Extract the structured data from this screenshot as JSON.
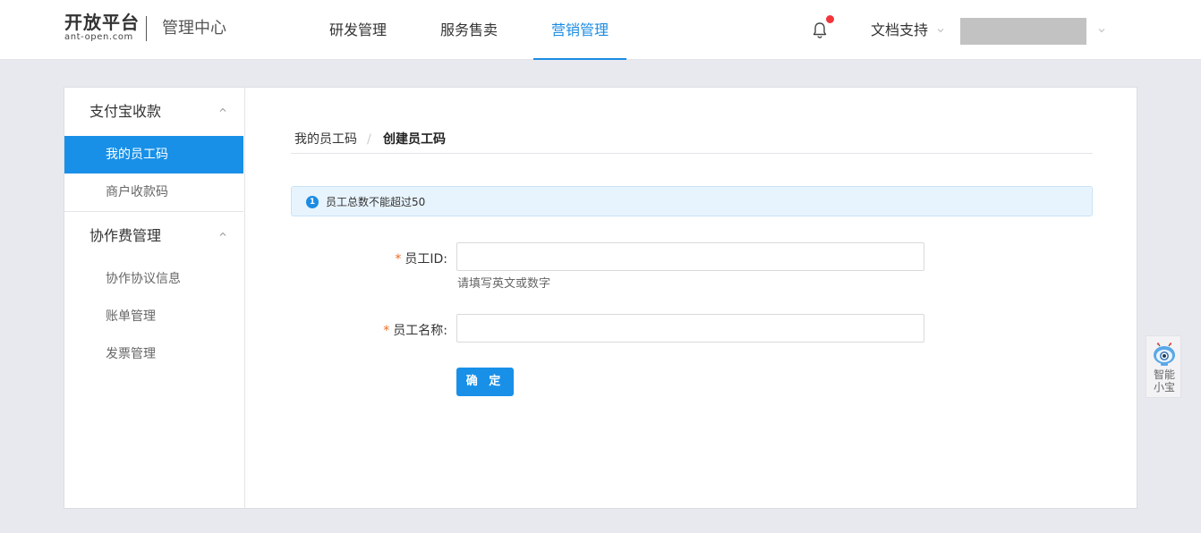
{
  "header": {
    "logo_main": "开放平台",
    "logo_sub": "ant-open.com",
    "logo_center": "管理中心",
    "nav": [
      {
        "label": "研发管理"
      },
      {
        "label": "服务售卖"
      },
      {
        "label": "营销管理",
        "active": true
      }
    ],
    "docs_label": "文档支持",
    "accent_color": "#1b8ce3",
    "notification_dot_color": "#f3343b"
  },
  "sidebar": {
    "groups": [
      {
        "title": "支付宝收款",
        "items": [
          {
            "label": "我的员工码",
            "active": true
          },
          {
            "label": "商户收款码"
          }
        ]
      },
      {
        "title": "协作费管理",
        "items": [
          {
            "label": "协作协议信息"
          },
          {
            "label": "账单管理"
          },
          {
            "label": "发票管理"
          }
        ]
      }
    ]
  },
  "breadcrumb": {
    "parent": "我的员工码",
    "separator": "/",
    "current": "创建员工码"
  },
  "alert": {
    "icon": "info-icon",
    "text": "员工总数不能超过50"
  },
  "form": {
    "required_mark": "*",
    "employee_id_label": "员工ID:",
    "employee_id_value": "",
    "employee_id_help": "请填写英文或数字",
    "employee_name_label": "员工名称:",
    "employee_name_value": "",
    "submit_label": "确 定"
  },
  "assistant": {
    "icon": "robot-icon",
    "label_line1": "智能",
    "label_line2": "小宝"
  }
}
